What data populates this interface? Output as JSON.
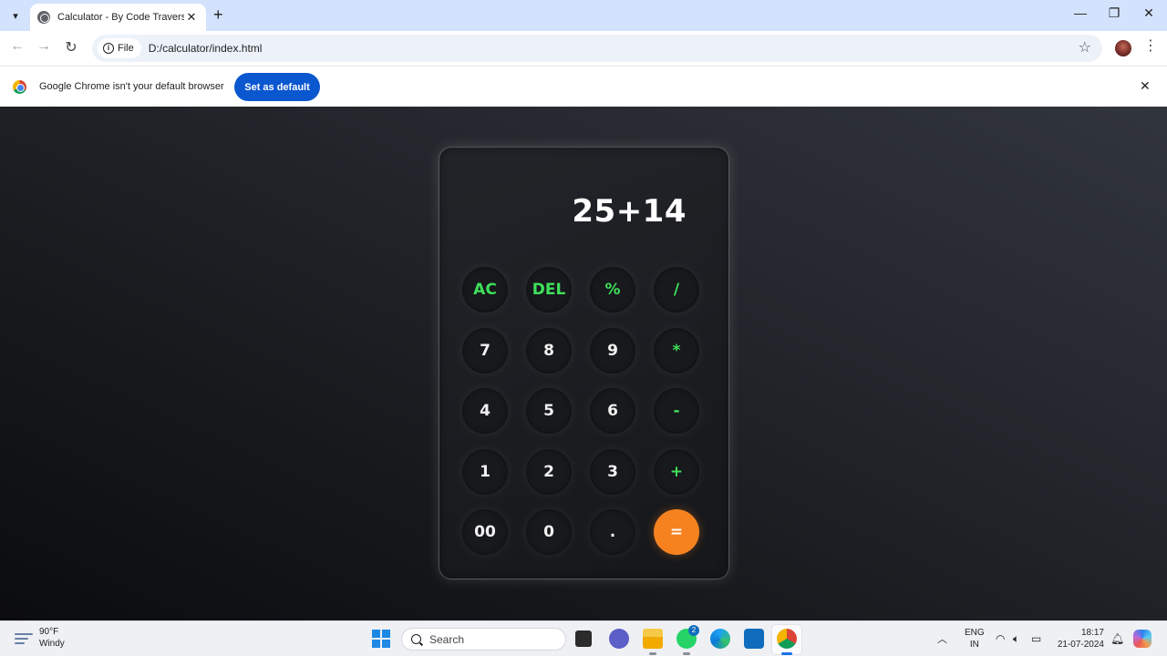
{
  "browser": {
    "tab_title": "Calculator - By Code Traversal",
    "site_chip_label": "File",
    "url": "D:/calculator/index.html"
  },
  "infobar": {
    "message": "Google Chrome isn't your default browser",
    "button_label": "Set as default"
  },
  "calculator": {
    "display": "25+14",
    "keys": [
      {
        "label": "AC",
        "kind": "op"
      },
      {
        "label": "DEL",
        "kind": "op"
      },
      {
        "label": "%",
        "kind": "op"
      },
      {
        "label": "/",
        "kind": "op"
      },
      {
        "label": "7",
        "kind": "digit"
      },
      {
        "label": "8",
        "kind": "digit"
      },
      {
        "label": "9",
        "kind": "digit"
      },
      {
        "label": "*",
        "kind": "op"
      },
      {
        "label": "4",
        "kind": "digit"
      },
      {
        "label": "5",
        "kind": "digit"
      },
      {
        "label": "6",
        "kind": "digit"
      },
      {
        "label": "-",
        "kind": "op"
      },
      {
        "label": "1",
        "kind": "digit"
      },
      {
        "label": "2",
        "kind": "digit"
      },
      {
        "label": "3",
        "kind": "digit"
      },
      {
        "label": "+",
        "kind": "op"
      },
      {
        "label": "00",
        "kind": "digit"
      },
      {
        "label": "0",
        "kind": "digit"
      },
      {
        "label": ".",
        "kind": "digit"
      },
      {
        "label": "=",
        "kind": "equals"
      }
    ],
    "colors": {
      "operator": "#3fe05a",
      "equals": "#f6821f",
      "digit": "#f2f2f2"
    }
  },
  "taskbar": {
    "weather_temp": "90°F",
    "weather_desc": "Windy",
    "search_placeholder": "Search",
    "whatsapp_badge": "2",
    "lang_line1": "ENG",
    "lang_line2": "IN",
    "time": "18:17",
    "date": "21-07-2024"
  }
}
